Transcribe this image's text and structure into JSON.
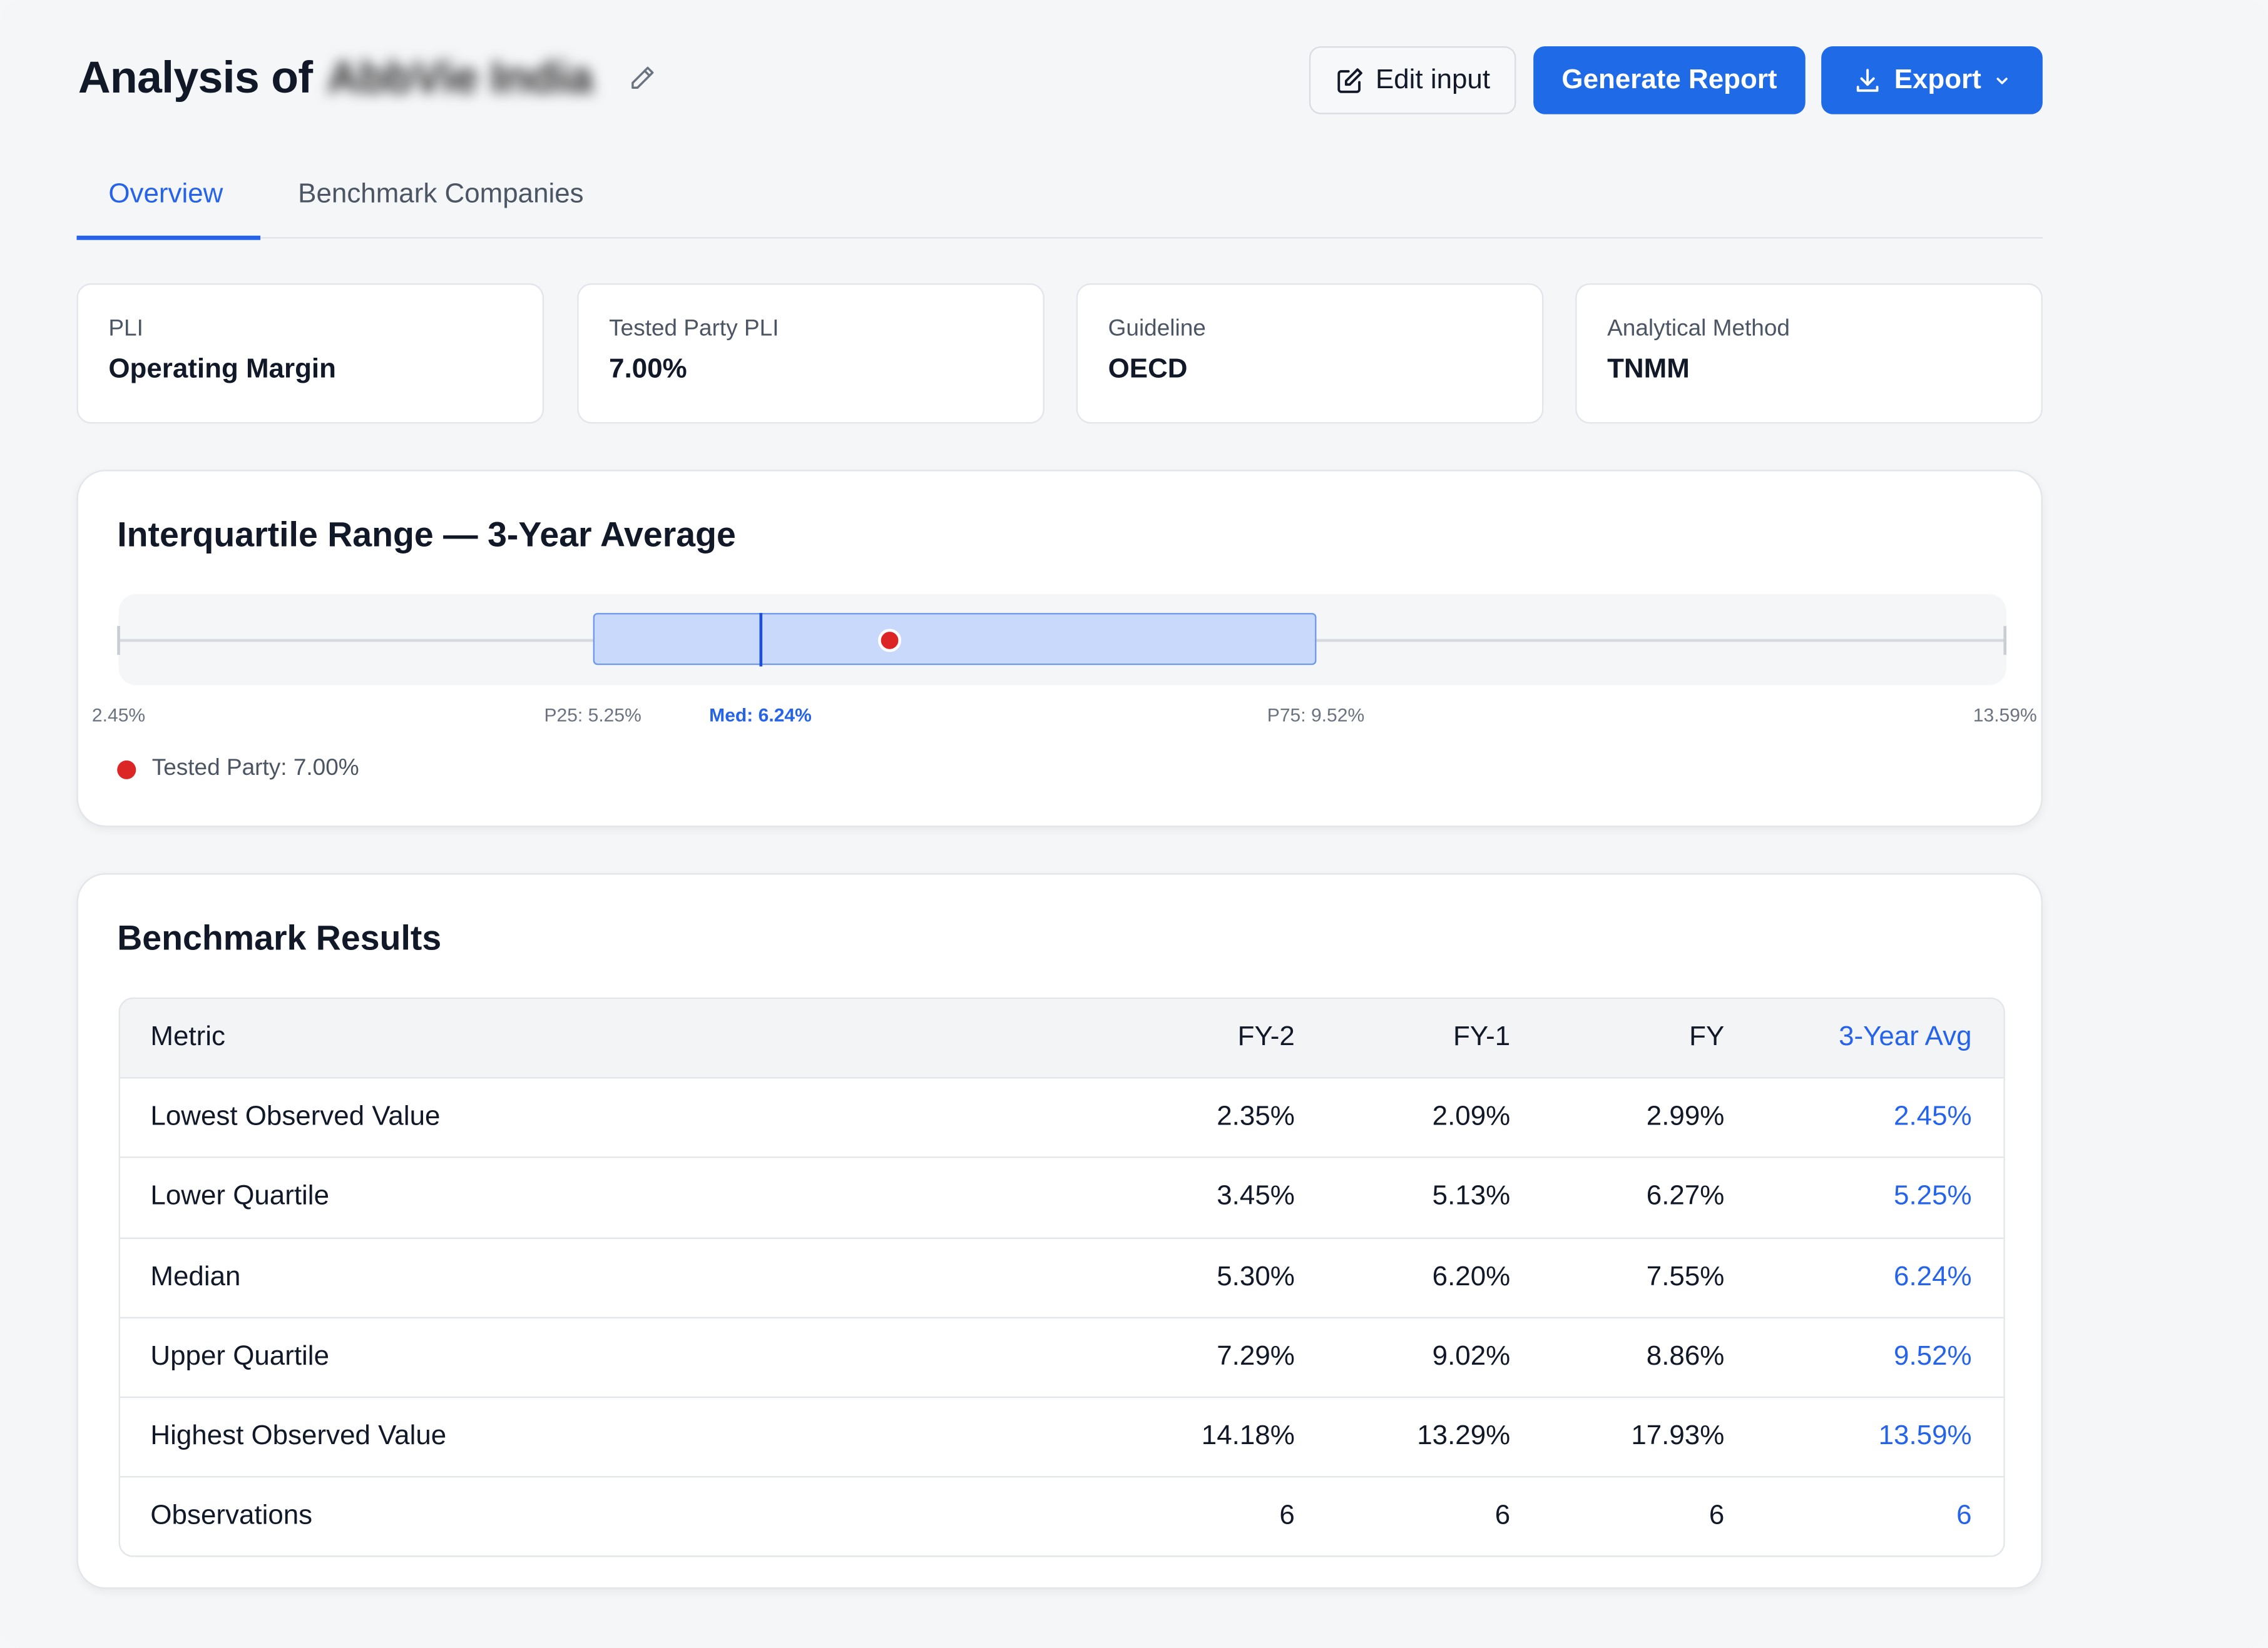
{
  "header": {
    "title_prefix": "Analysis of",
    "company_name": "AbbVie India",
    "edit_label": "Edit input",
    "generate_label": "Generate Report",
    "export_label": "Export"
  },
  "tabs": [
    {
      "label": "Overview",
      "active": true
    },
    {
      "label": "Benchmark Companies",
      "active": false
    }
  ],
  "info_cards": [
    {
      "label": "PLI",
      "value": "Operating Margin"
    },
    {
      "label": "Tested Party PLI",
      "value": "7.00%"
    },
    {
      "label": "Guideline",
      "value": "OECD"
    },
    {
      "label": "Analytical Method",
      "value": "TNMM"
    }
  ],
  "iqr": {
    "title": "Interquartile Range — 3-Year Average",
    "labels": {
      "min": "2.45%",
      "p25": "P25: 5.25%",
      "median": "Med: 6.24%",
      "p75": "P75: 9.52%",
      "max": "13.59%"
    },
    "legend": "Tested Party: 7.00%",
    "colors": {
      "box": "#c9d9fb",
      "median": "#1d4ed8",
      "tested_party": "#dc2626"
    }
  },
  "chart_data": {
    "type": "box",
    "title": "Interquartile Range — 3-Year Average",
    "min": 2.45,
    "p25": 5.25,
    "median": 6.24,
    "p75": 9.52,
    "max": 13.59,
    "tested_party": 7.0,
    "unit": "%"
  },
  "benchmark": {
    "title": "Benchmark Results",
    "columns": [
      "Metric",
      "FY-2",
      "FY-1",
      "FY",
      "3-Year Avg"
    ],
    "rows": [
      [
        "Lowest Observed Value",
        "2.35%",
        "2.09%",
        "2.99%",
        "2.45%"
      ],
      [
        "Lower Quartile",
        "3.45%",
        "5.13%",
        "6.27%",
        "5.25%"
      ],
      [
        "Median",
        "5.30%",
        "6.20%",
        "7.55%",
        "6.24%"
      ],
      [
        "Upper Quartile",
        "7.29%",
        "9.02%",
        "8.86%",
        "9.52%"
      ],
      [
        "Highest Observed Value",
        "14.18%",
        "13.29%",
        "17.93%",
        "13.59%"
      ],
      [
        "Observations",
        "6",
        "6",
        "6",
        "6"
      ]
    ]
  }
}
